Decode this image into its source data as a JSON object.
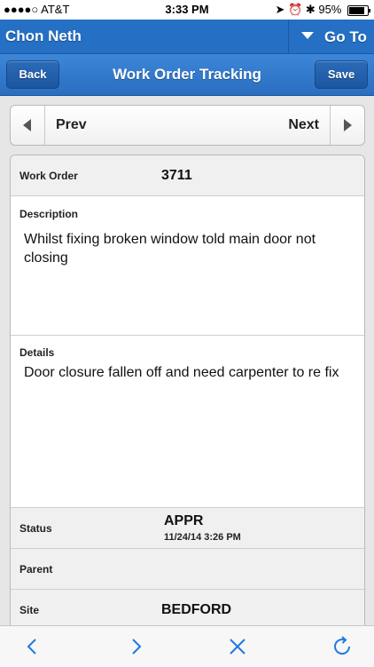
{
  "status_bar": {
    "carrier": "●●●●○ AT&T",
    "time": "3:33 PM",
    "battery": "95%",
    "battery_level": 0.95
  },
  "user_bar": {
    "user_name": "Chon Neth",
    "goto_label": "Go To"
  },
  "nav": {
    "back_label": "Back",
    "title": "Work Order Tracking",
    "save_label": "Save"
  },
  "pager": {
    "prev_label": "Prev",
    "next_label": "Next"
  },
  "form": {
    "work_order": {
      "label": "Work Order",
      "value": "3711"
    },
    "description": {
      "label": "Description",
      "value": "Whilst fixing broken window told main door not closing"
    },
    "details": {
      "label": "Details",
      "value": "Door closure fallen off and need carpenter to re fix"
    },
    "status": {
      "label": "Status",
      "value": "APPR",
      "date": "11/24/14 3:26 PM"
    },
    "parent": {
      "label": "Parent",
      "value": ""
    },
    "site": {
      "label": "Site",
      "value": "BEDFORD"
    }
  },
  "colors": {
    "accent": "#2570c4",
    "toolbar_icon": "#1f7ae0"
  },
  "toolbar_icons": [
    "back-arrow-icon",
    "forward-arrow-icon",
    "close-icon",
    "refresh-icon"
  ]
}
